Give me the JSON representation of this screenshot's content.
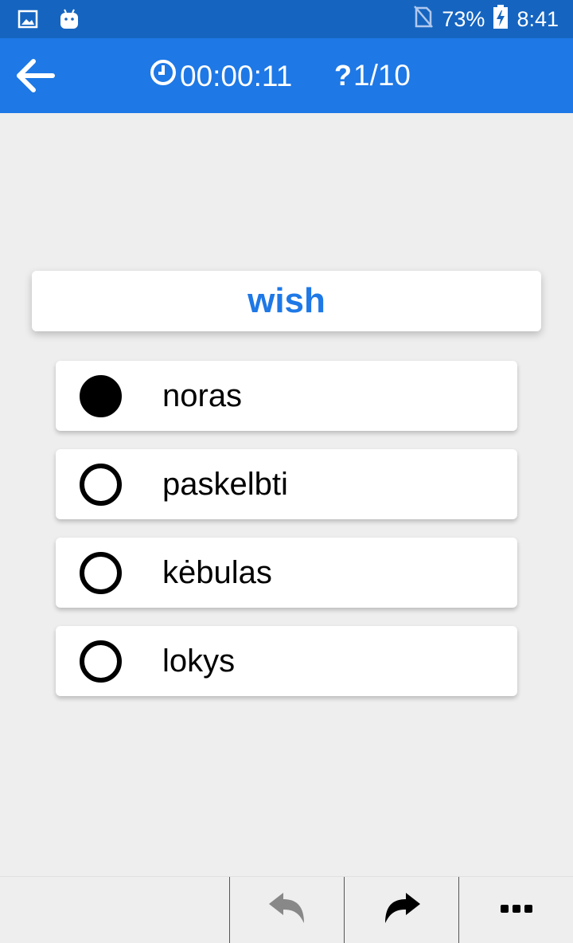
{
  "status_bar": {
    "battery_percent": "73%",
    "time": "8:41",
    "icons": [
      "image-icon",
      "android-icon",
      "no-sim-icon",
      "battery-charging-icon"
    ]
  },
  "app_bar": {
    "back_icon": "arrow-left-icon",
    "timer_icon": "clock-icon",
    "timer": "00:00:11",
    "progress_icon": "question-mark-icon",
    "progress": "1/10"
  },
  "quiz": {
    "word": "wish",
    "options": [
      {
        "label": "noras",
        "selected": true
      },
      {
        "label": "paskelbti",
        "selected": false
      },
      {
        "label": "kėbulas",
        "selected": false
      },
      {
        "label": "lokys",
        "selected": false
      }
    ]
  },
  "bottom_bar": {
    "icons": [
      "undo-icon",
      "redo-icon",
      "more-icon"
    ]
  },
  "colors": {
    "status_bar": "#1565c0",
    "app_bar": "#1e78e6",
    "accent_text": "#1e78e6",
    "background": "#eeeeee"
  }
}
